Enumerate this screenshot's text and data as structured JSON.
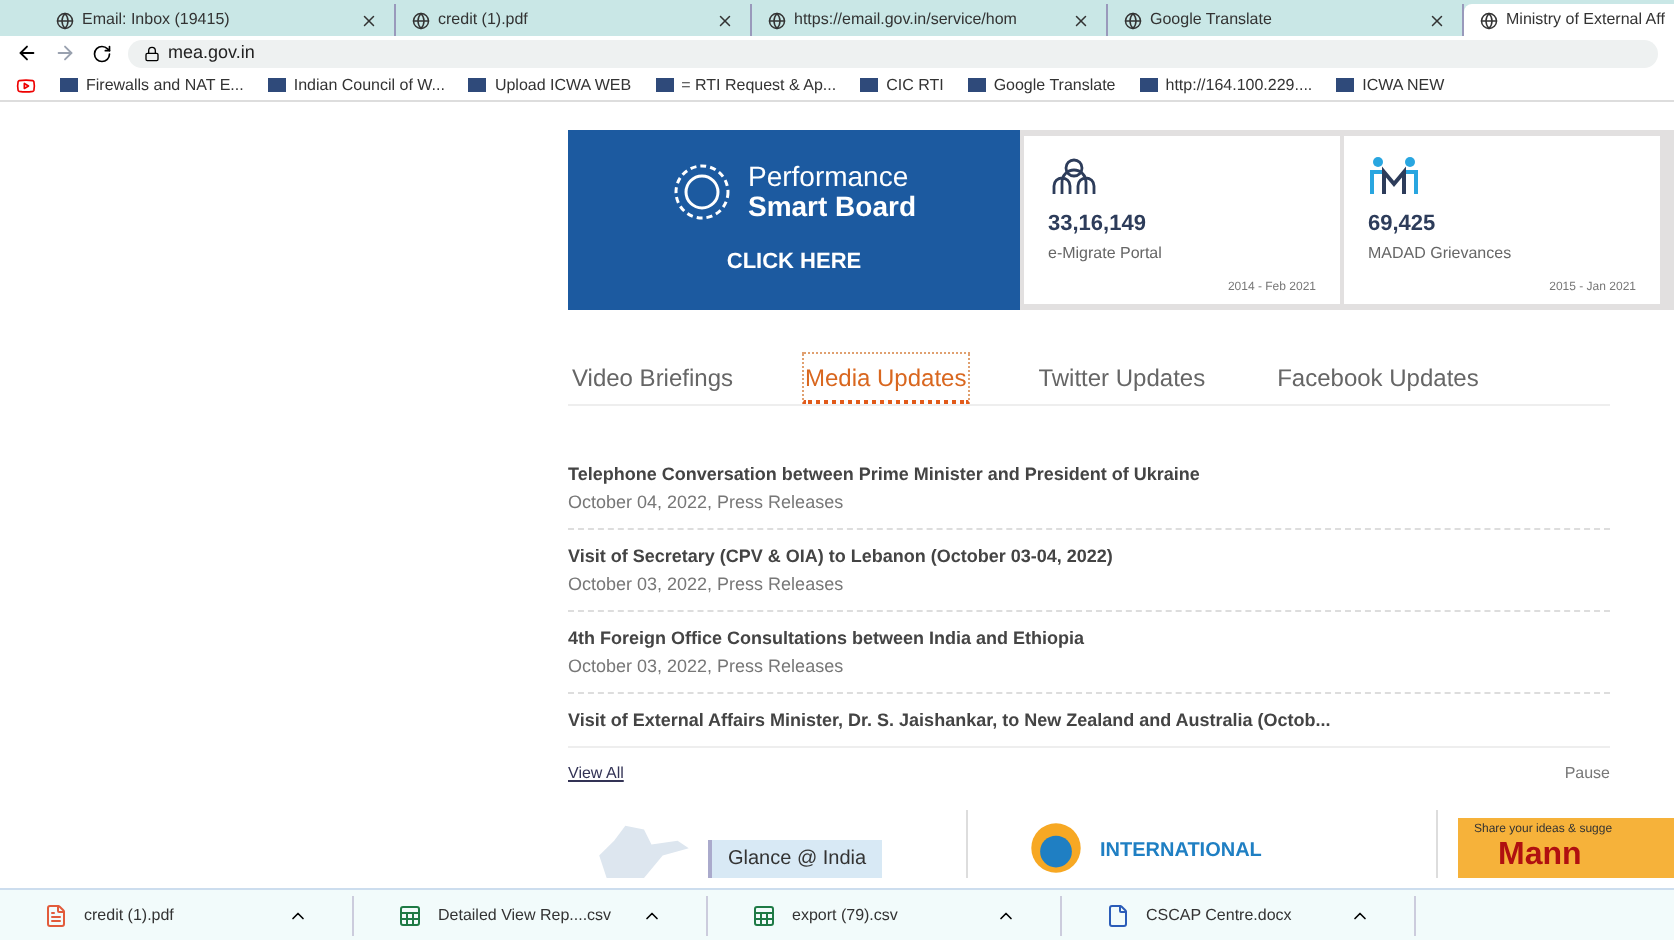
{
  "browser_tabs": [
    {
      "title": "Email: Inbox (19415)",
      "selected": false
    },
    {
      "title": "credit (1).pdf",
      "selected": false
    },
    {
      "title": "https://email.gov.in/service/hom",
      "selected": false
    },
    {
      "title": "Google Translate",
      "selected": false
    },
    {
      "title": "Ministry of External Aff",
      "selected": true
    }
  ],
  "address": "mea.gov.in",
  "bookmarks": [
    "Firewalls and NAT E...",
    "Indian Council of W...",
    "Upload ICWA WEB",
    "= RTI Request & Ap...",
    "CIC RTI",
    "Google Translate",
    "http://164.100.229....",
    "ICWA NEW"
  ],
  "banner": {
    "title_line_1": "Performance",
    "title_line_2": "Smart Board",
    "cta": "CLICK HERE"
  },
  "stats": [
    {
      "value": "33,16,149",
      "label": "e-Migrate Portal",
      "period": "2014 - Feb 2021"
    },
    {
      "value": "69,425",
      "label": "MADAD Grievances",
      "period": "2015 - Jan 2021"
    }
  ],
  "tabs": [
    {
      "label": "Video Briefings",
      "selected": false
    },
    {
      "label": "Media Updates",
      "selected": true
    },
    {
      "label": "Twitter Updates",
      "selected": false
    },
    {
      "label": "Facebook Updates",
      "selected": false
    }
  ],
  "news": [
    {
      "title": "Telephone Conversation between Prime Minister and President of Ukraine",
      "meta": "October 04, 2022, Press Releases"
    },
    {
      "title": "Visit of Secretary (CPV & OIA) to Lebanon (October 03-04, 2022)",
      "meta": "October 03, 2022, Press Releases"
    },
    {
      "title": "4th Foreign Office Consultations between India and Ethiopia",
      "meta": "October 03, 2022, Press Releases"
    },
    {
      "title": "Visit of External Affairs Minister, Dr. S. Jaishankar, to New Zealand and Australia (Octob..."
    }
  ],
  "view_all": "View All",
  "pause": "Pause",
  "promos": {
    "glance": "Glance @ India",
    "yoga": "INTERNATIONAL",
    "mann_tagline": "Share your ideas & sugge",
    "mann": "Mann"
  },
  "downloads": [
    {
      "name": "credit (1).pdf",
      "kind": "pdf"
    },
    {
      "name": "Detailed View Rep....csv",
      "kind": "sheet"
    },
    {
      "name": "export (79).csv",
      "kind": "sheet"
    },
    {
      "name": "CSCAP Centre.docx",
      "kind": "doc"
    }
  ]
}
